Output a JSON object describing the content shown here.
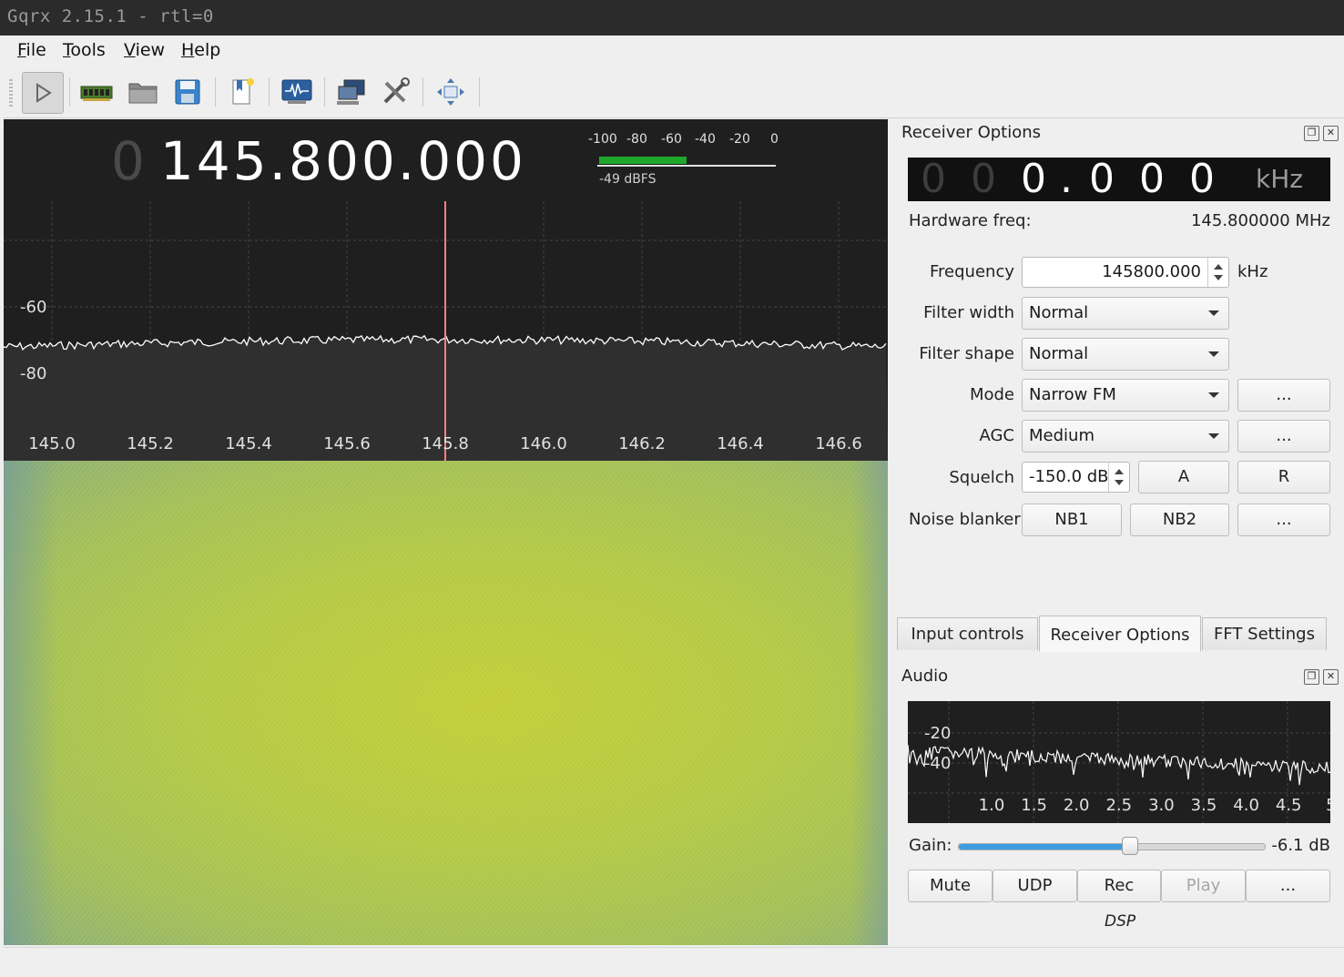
{
  "window": {
    "title": "Gqrx 2.15.1 - rtl=0"
  },
  "menu": [
    "File",
    "Tools",
    "View",
    "Help"
  ],
  "toolbar": {
    "icons": [
      "play-icon",
      "device-icon",
      "open-file-icon",
      "save-icon",
      "bookmark-icon",
      "waveform-icon",
      "remote-control-icon",
      "tools-icon",
      "fullscreen-icon"
    ],
    "colors": {
      "play_active": "#d8d8d8"
    }
  },
  "main_display": {
    "freq_lead": "0",
    "freq_value": "145.800.000",
    "meter_scale": [
      "-100",
      "-80",
      "-60",
      "-40",
      "-20",
      "0"
    ],
    "meter_level_fraction": 0.49,
    "meter_readout": "-49 dBFS"
  },
  "spectrum": {
    "y_labels": [
      "-60",
      "-80"
    ],
    "x_labels": [
      "145.0",
      "145.2",
      "145.4",
      "145.6",
      "145.8",
      "146.0",
      "146.2",
      "146.4",
      "146.6"
    ],
    "colors": {
      "marker": "#ff8080",
      "trace": "#ffffff",
      "noise_fill": "#2f2f2f",
      "grid": "#444444"
    }
  },
  "receiver": {
    "title": "Receiver Options",
    "lcd": {
      "d1": "0",
      "d2": "0",
      "d3": "0",
      "dot": ".",
      "d4": "0",
      "d5": "0",
      "d6": "0",
      "unit": "kHz"
    },
    "hardware_freq_label": "Hardware freq:",
    "hardware_freq_value": "145.800000 MHz",
    "frequency_label": "Frequency",
    "frequency_value": "145800.000",
    "frequency_unit": "kHz",
    "filter_width_label": "Filter width",
    "filter_width_value": "Normal",
    "filter_shape_label": "Filter shape",
    "filter_shape_value": "Normal",
    "mode_label": "Mode",
    "mode_value": "Narrow FM",
    "agc_label": "AGC",
    "agc_value": "Medium",
    "squelch_label": "Squelch",
    "squelch_value": "-150.0 dB",
    "squelch_a": "A",
    "squelch_r": "R",
    "noise_blanker_label": "Noise blanker",
    "nb1": "NB1",
    "nb2": "NB2",
    "more": "..."
  },
  "tabs": [
    {
      "label": "Input controls"
    },
    {
      "label": "Receiver Options"
    },
    {
      "label": "FFT Settings"
    }
  ],
  "audio": {
    "title": "Audio",
    "y_labels": [
      "-20",
      "-40"
    ],
    "x_labels": [
      "1.0",
      "1.5",
      "2.0",
      "2.5",
      "3.0",
      "3.5",
      "4.0",
      "4.5",
      "5"
    ],
    "gain_label": "Gain:",
    "gain_value": "-6.1 dB",
    "gain_fraction": 0.56,
    "buttons": {
      "mute": "Mute",
      "udp": "UDP",
      "rec": "Rec",
      "play": "Play",
      "more": "..."
    },
    "footer": "DSP"
  }
}
